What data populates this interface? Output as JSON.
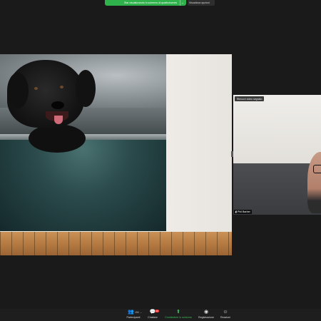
{
  "banner": {
    "share_status": "Stai visualizzando lo schermo di quattrohomes",
    "view_options": "Visualizza opzioni"
  },
  "participant": {
    "badge": "Rimuovi video segnato",
    "name": "Phil Barber"
  },
  "toolbar": {
    "participants_label": "Partecipanti",
    "participants_count": "194",
    "chat_label": "Chattare",
    "chat_badge": "13",
    "share_label": "Condividere lo schermo",
    "record_label": "Registrazione",
    "reactions_label": "Reazioni"
  },
  "colors": {
    "accent_green": "#2fb24c",
    "toolbar_bg": "#1e1e1e",
    "app_bg": "#1a1a1a"
  },
  "icons": {
    "participants": "people-icon",
    "chat": "chat-bubble-icon",
    "share": "share-screen-icon",
    "record": "record-icon",
    "reactions": "smiley-icon",
    "mic_muted": "mic-muted-icon"
  }
}
